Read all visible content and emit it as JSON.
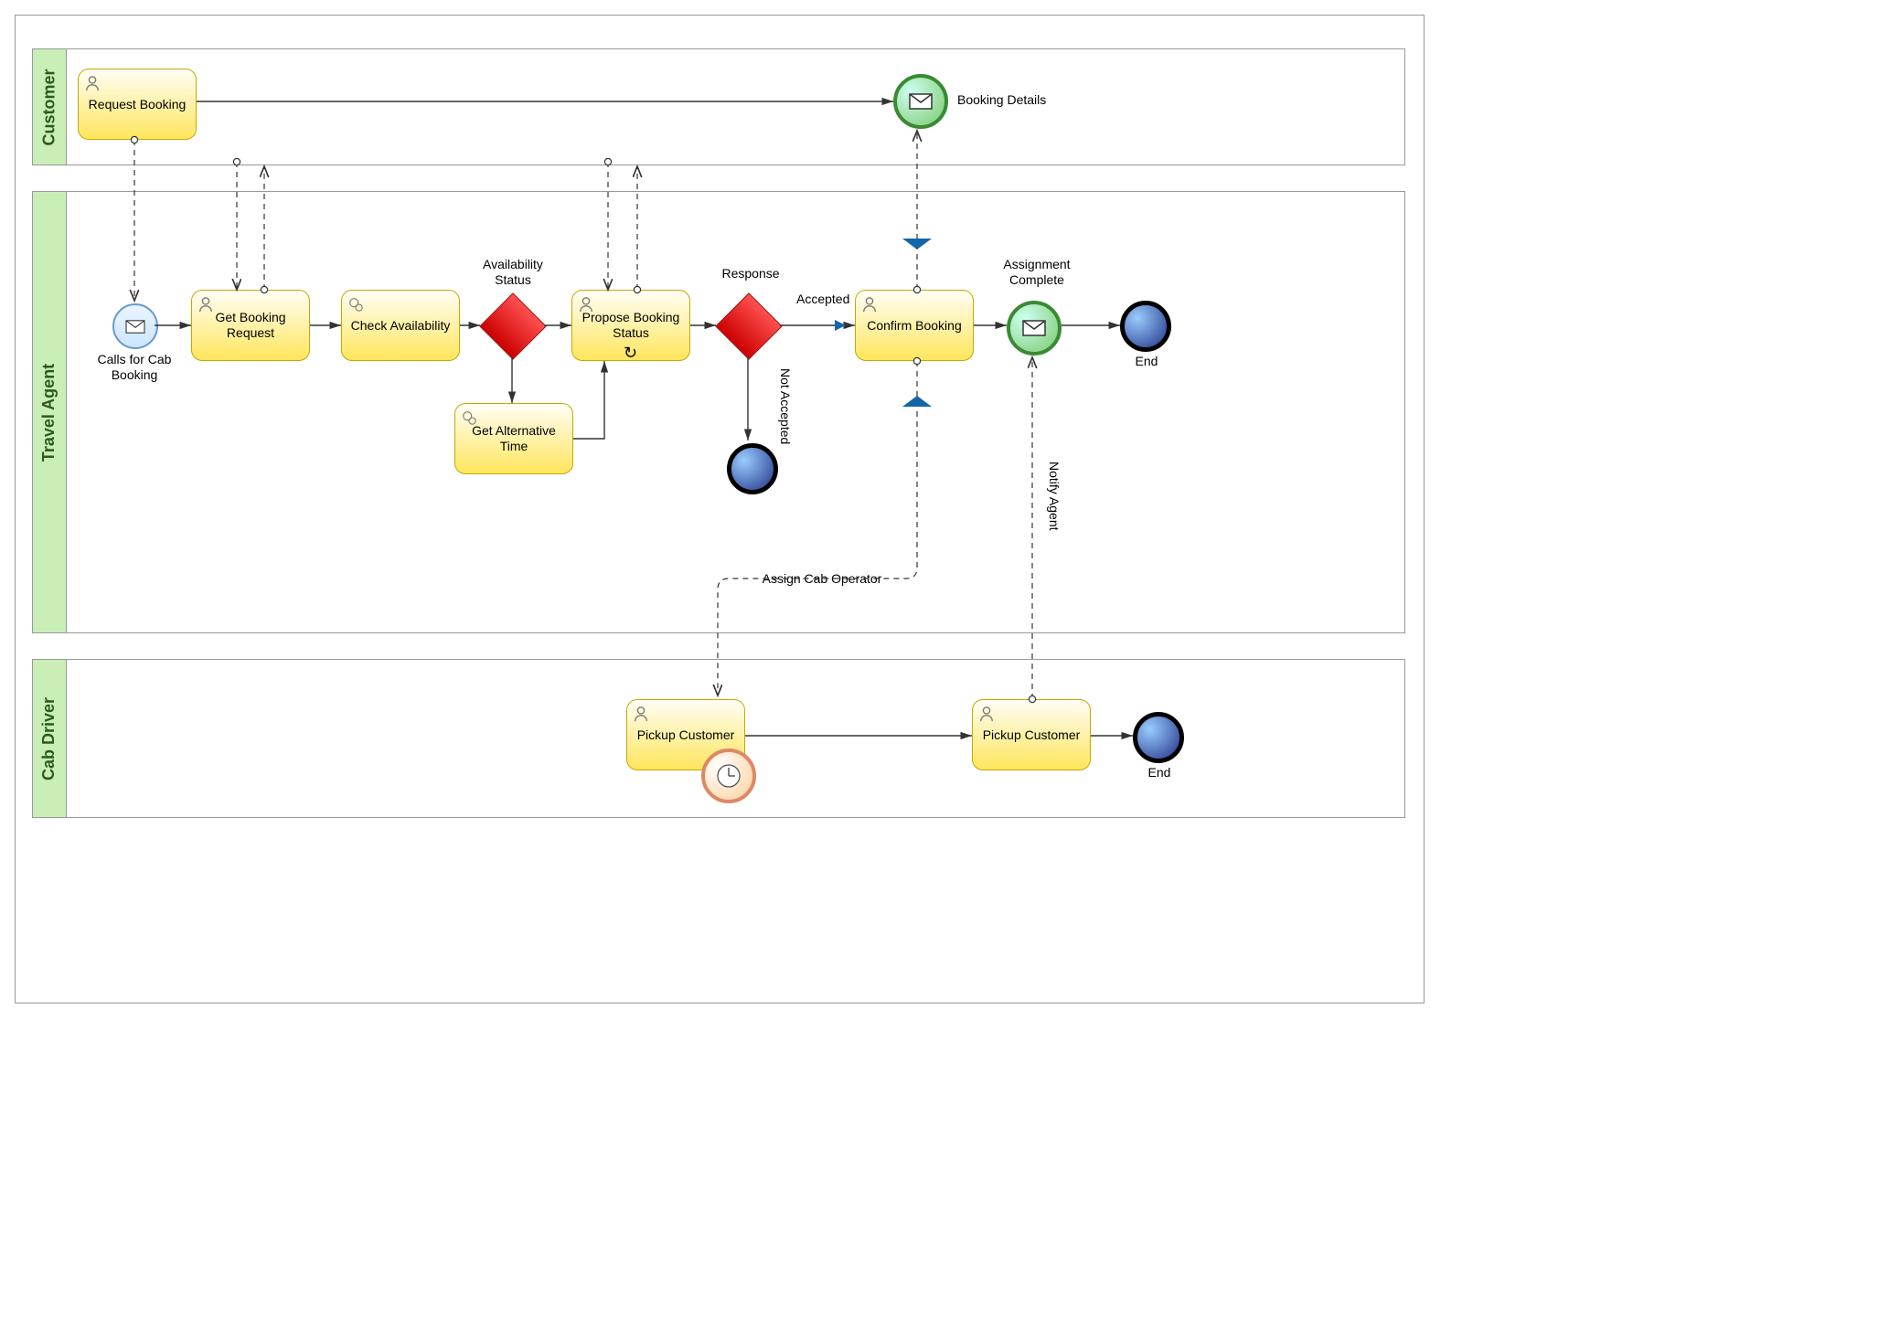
{
  "lanes": {
    "customer": "Customer",
    "travel_agent": "Travel Agent",
    "cab_driver": "Cab Driver"
  },
  "tasks": {
    "request_booking": "Request Booking",
    "get_booking_request": "Get Booking Request",
    "check_availability": "Check Availability",
    "propose_booking_status": "Propose Booking Status",
    "get_alternative_time": "Get Alternative Time",
    "confirm_booking": "Confirm Booking",
    "pickup_customer_1": "Pickup Customer",
    "pickup_customer_2": "Pickup Customer"
  },
  "events": {
    "booking_details": "Booking Details",
    "calls_for_cab_booking": "Calls for Cab Booking",
    "assignment_complete": "Assignment Complete",
    "end_agent": "End",
    "end_driver": "End"
  },
  "gateways": {
    "availability_status": "Availability Status",
    "response": "Response"
  },
  "edge_labels": {
    "accepted": "Accepted",
    "not_accepted": "Not Accepted",
    "assign_cab_operator": "Assign Cab Operator",
    "notify_agent": "Notify Agent"
  }
}
